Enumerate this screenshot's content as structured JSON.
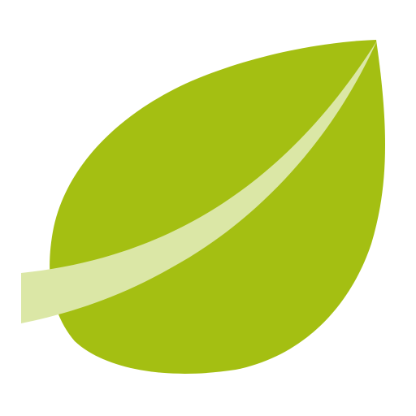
{
  "colors": {
    "background": "#ffffff",
    "leaf": "#a4bf12",
    "vein": "#dbe7a6"
  },
  "icon": {
    "name": "leaf-icon"
  }
}
